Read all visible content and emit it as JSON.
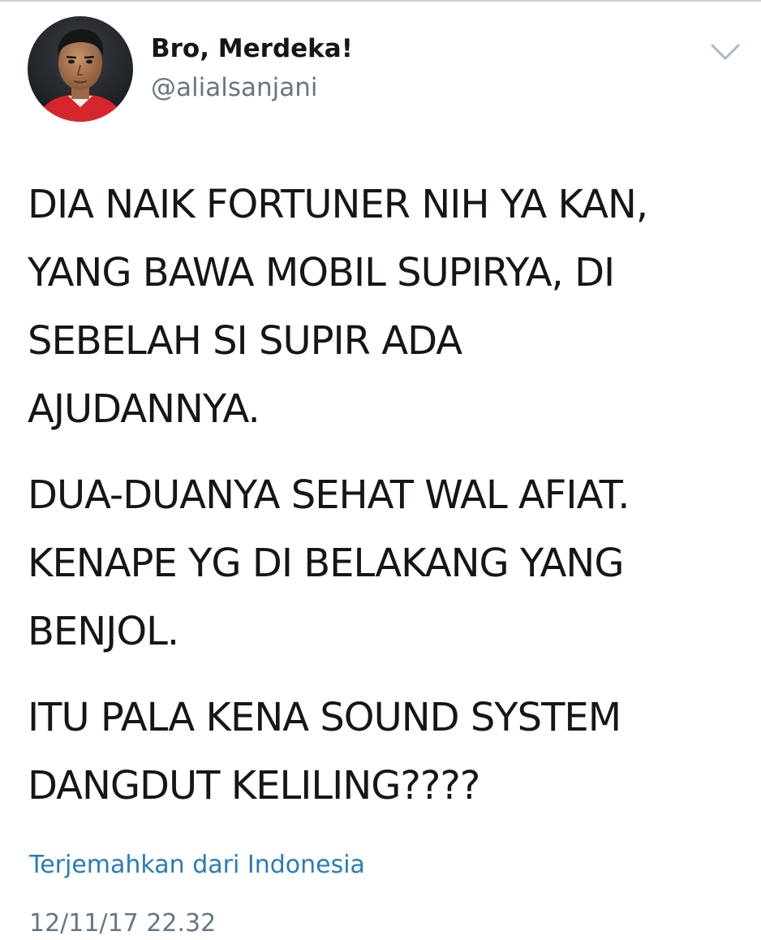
{
  "author": {
    "display_name": "Bro, Merdeka!",
    "handle": "@alialsanjani",
    "avatar_icon": "profile-photo-avatar"
  },
  "menu": {
    "icon": "chevron-down-icon",
    "color": "#aab8c2"
  },
  "tweet": {
    "paragraphs": [
      {
        "lines": [
          "DIA NAIK FORTUNER NIH YA KAN,",
          "YANG BAWA MOBIL SUPIRYA, DI",
          "SEBELAH SI SUPIR ADA",
          "AJUDANNYA."
        ]
      },
      {
        "lines": [
          "DUA-DUANYA SEHAT WAL AFIAT.",
          "KENAPE YG DI BELAKANG YANG",
          "BENJOL."
        ]
      },
      {
        "lines": [
          "ITU PALA KENA SOUND SYSTEM",
          "DANGDUT KELILING????"
        ]
      }
    ]
  },
  "translate": {
    "label": "Terjemahkan dari Indonesia",
    "color": "#2b7bb9"
  },
  "meta": {
    "timestamp": "12/11/17 22.32"
  }
}
